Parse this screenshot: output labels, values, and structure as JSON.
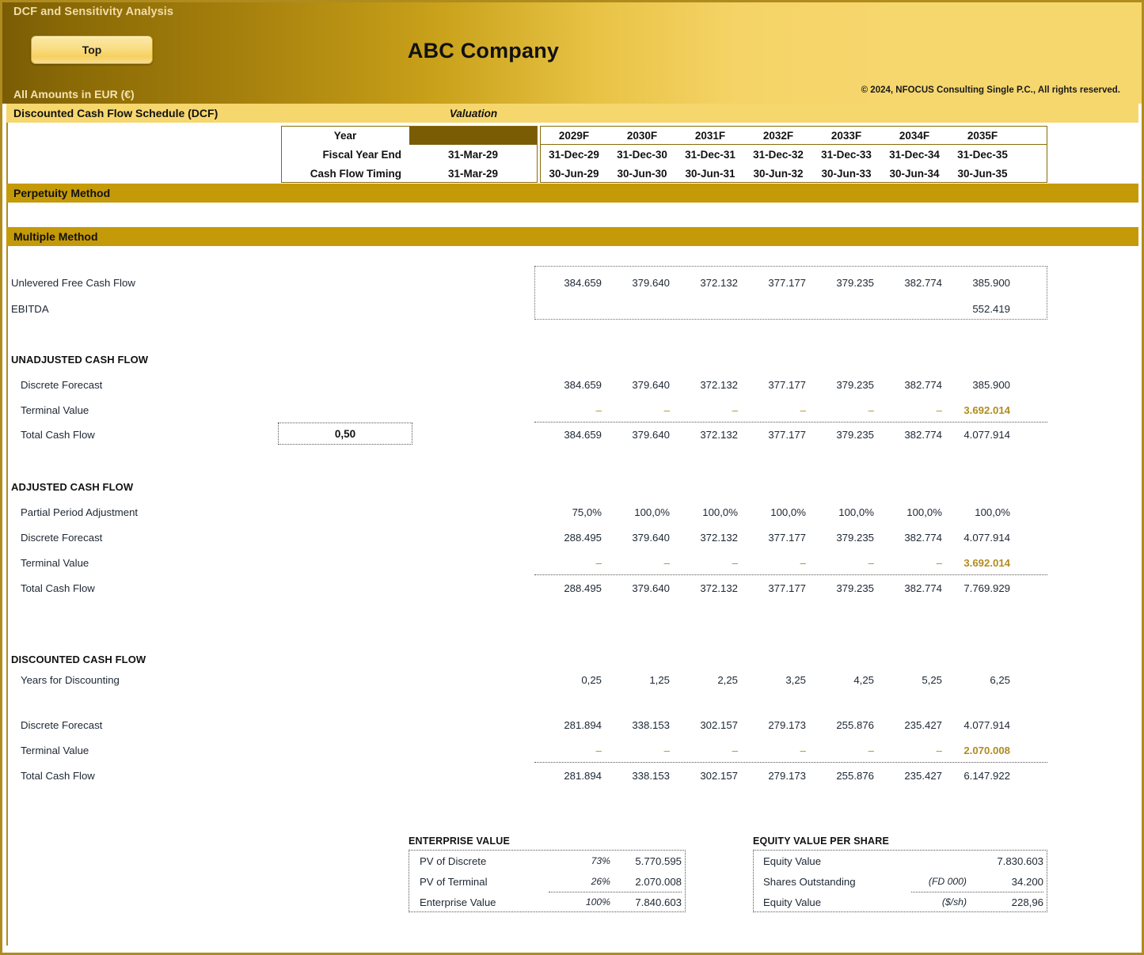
{
  "header": {
    "sheet_title": "DCF and Sensitivity Analysis",
    "top_button": "Top",
    "company": "ABC Company",
    "amounts_note": "All Amounts in  EUR (€)",
    "copyright": "© 2024, NFOCUS Consulting Single P.C., All rights reserved."
  },
  "bands": {
    "dcf_schedule": "Discounted Cash Flow Schedule (DCF)",
    "valuation": "Valuation",
    "perpetuity_method": "Perpetuity Method",
    "multiple_method": "Multiple Method"
  },
  "columns": {
    "row_labels": [
      "Year",
      "Fiscal Year End",
      "Cash Flow Timing"
    ],
    "valuation": [
      "",
      "31-Mar-29",
      "31-Mar-29"
    ],
    "years": [
      "2029F",
      "2030F",
      "2031F",
      "2032F",
      "2033F",
      "2034F",
      "2035F"
    ],
    "fiscal_year_end": [
      "31-Dec-29",
      "31-Dec-30",
      "31-Dec-31",
      "31-Dec-32",
      "31-Dec-33",
      "31-Dec-34",
      "31-Dec-35"
    ],
    "cash_flow_timing": [
      "30-Jun-29",
      "30-Jun-30",
      "30-Jun-31",
      "30-Jun-32",
      "30-Jun-33",
      "30-Jun-34",
      "30-Jun-35"
    ]
  },
  "inputs": {
    "partial_period_factor": "0,50"
  },
  "rows": {
    "ufcf": {
      "label": "Unlevered Free Cash Flow",
      "values": [
        "384.659",
        "379.640",
        "372.132",
        "377.177",
        "379.235",
        "382.774",
        "385.900"
      ]
    },
    "ebitda": {
      "label": "EBITDA",
      "values": [
        "",
        "",
        "",
        "",
        "",
        "",
        "552.419"
      ]
    },
    "unadjusted": {
      "title": "UNADJUSTED CASH FLOW",
      "discrete": {
        "label": "Discrete Forecast",
        "values": [
          "384.659",
          "379.640",
          "372.132",
          "377.177",
          "379.235",
          "382.774",
          "385.900"
        ]
      },
      "terminal": {
        "label": "Terminal Value",
        "values": [
          "–",
          "–",
          "–",
          "–",
          "–",
          "–",
          "3.692.014"
        ]
      },
      "total": {
        "label": "Total Cash Flow",
        "values": [
          "384.659",
          "379.640",
          "372.132",
          "377.177",
          "379.235",
          "382.774",
          "4.077.914"
        ]
      }
    },
    "adjusted": {
      "title": "ADJUSTED CASH FLOW",
      "partial": {
        "label": "Partial Period Adjustment",
        "values": [
          "75,0%",
          "100,0%",
          "100,0%",
          "100,0%",
          "100,0%",
          "100,0%",
          "100,0%"
        ]
      },
      "discrete": {
        "label": "Discrete Forecast",
        "values": [
          "288.495",
          "379.640",
          "372.132",
          "377.177",
          "379.235",
          "382.774",
          "4.077.914"
        ]
      },
      "terminal": {
        "label": "Terminal Value",
        "values": [
          "–",
          "–",
          "–",
          "–",
          "–",
          "–",
          "3.692.014"
        ]
      },
      "total": {
        "label": "Total Cash Flow",
        "values": [
          "288.495",
          "379.640",
          "372.132",
          "377.177",
          "379.235",
          "382.774",
          "7.769.929"
        ]
      }
    },
    "discounted": {
      "title": "DISCOUNTED CASH FLOW",
      "years_disc": {
        "label": "Years for Discounting",
        "values": [
          "0,25",
          "1,25",
          "2,25",
          "3,25",
          "4,25",
          "5,25",
          "6,25"
        ]
      },
      "discrete": {
        "label": "Discrete Forecast",
        "values": [
          "281.894",
          "338.153",
          "302.157",
          "279.173",
          "255.876",
          "235.427",
          "4.077.914"
        ]
      },
      "terminal": {
        "label": "Terminal Value",
        "values": [
          "–",
          "–",
          "–",
          "–",
          "–",
          "–",
          "2.070.008"
        ]
      },
      "total": {
        "label": "Total Cash Flow",
        "values": [
          "281.894",
          "338.153",
          "302.157",
          "279.173",
          "255.876",
          "235.427",
          "6.147.922"
        ]
      }
    }
  },
  "enterprise_value": {
    "title": "ENTERPRISE VALUE",
    "rows": [
      {
        "label": "PV of Discrete",
        "pct": "73%",
        "value": "5.770.595"
      },
      {
        "label": "PV of Terminal",
        "pct": "26%",
        "value": "2.070.008"
      },
      {
        "label": "Enterprise Value",
        "pct": "100%",
        "value": "7.840.603"
      }
    ]
  },
  "equity_value": {
    "title": "EQUITY VALUE PER SHARE",
    "rows": [
      {
        "label": "Equity Value",
        "unit": "",
        "value": "7.830.603"
      },
      {
        "label": "Shares Outstanding",
        "unit": "(FD 000)",
        "value": "34.200"
      },
      {
        "label": "Equity Value",
        "unit": "($/sh)",
        "value": "228,96"
      }
    ]
  },
  "colors": {
    "gold_band": "#c59a08",
    "light_band": "#f6d76e",
    "accent_gold": "#b08b1e",
    "dark_header": "#7a5c05",
    "text": "#1d2733"
  }
}
